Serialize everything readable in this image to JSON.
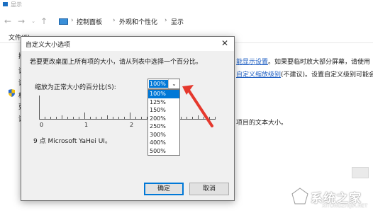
{
  "background": {
    "title": "显示",
    "breadcrumbs": [
      "控制面板",
      "外观和个性化",
      "显示"
    ],
    "menu": {
      "file": "文件(F)"
    },
    "side_links": [
      "控",
      "调",
      "调",
      "校",
      "更",
      "调"
    ],
    "right_text": {
      "line1_link": "能显示设置",
      "line1_rest": "。如果要临时放大部分屏幕，请使用",
      "line2_link": "自定义缩放级别",
      "line2_rest": "(不建议)。设置自定义级别可能会",
      "line3": "项目的文本大小。"
    },
    "watermark": {
      "text": "系统之家",
      "url": "XITONGZHIJIA.NET"
    }
  },
  "dialog": {
    "title": "自定义大小选项",
    "close_glyph": "✕",
    "instruction": "若要更改桌面上所有项的大小，请从列表中选择一个百分比。",
    "scale_label": "缩放为正常大小的百分比(S):",
    "scale_value": "100%",
    "scale_options": [
      "100%",
      "125%",
      "150%",
      "200%",
      "250%",
      "300%",
      "400%",
      "500%"
    ],
    "ruler_numbers": [
      "0",
      "1",
      "2",
      "3"
    ],
    "font_sample": "9 点 Microsoft YaHei UI。",
    "ok_label": "确定",
    "cancel_label": "取消"
  },
  "colors": {
    "accent": "#0078d7",
    "arrow": "#e5382d",
    "link": "#1f5fc3"
  },
  "icons": [
    "back-arrow-icon",
    "forward-arrow-icon",
    "up-arrow-icon",
    "computer-icon",
    "shield-icon",
    "chevron-down-icon",
    "close-icon"
  ]
}
